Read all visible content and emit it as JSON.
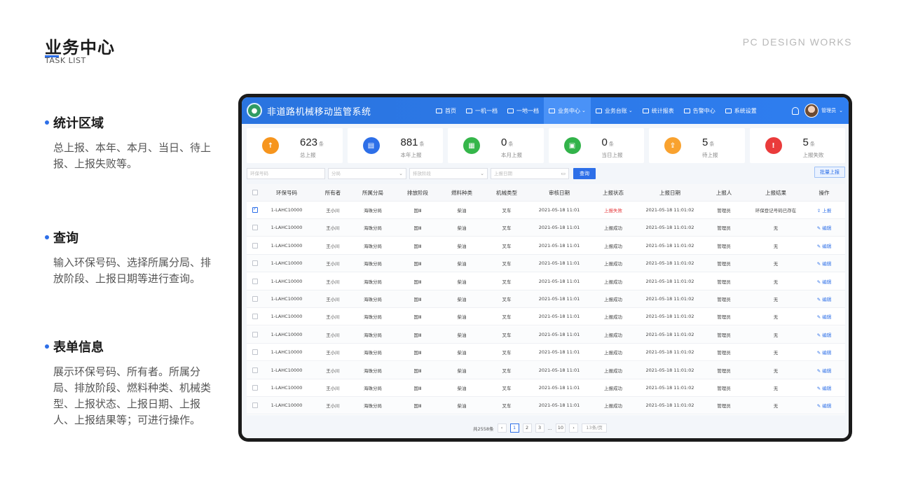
{
  "header": {
    "title": "业务中心",
    "subtitle": "TASK LIST",
    "right_caption": "PC DESIGN WORKS"
  },
  "sections": [
    {
      "title": "统计区域",
      "text": "总上报、本年、本月、当日、待上报、上报失败等。"
    },
    {
      "title": "查询",
      "text": "输入环保号码、选择所属分局、排放阶段、上报日期等进行查询。"
    },
    {
      "title": "表单信息",
      "text": "展示环保号码、所有者。所属分局、排放阶段、燃料种类、机械类型、上报状态、上报日期、上报人、上报结果等；可进行操作。"
    }
  ],
  "app": {
    "title": "非道路机械移动监管系统",
    "nav": [
      {
        "label": "首页",
        "caret": false,
        "active": false
      },
      {
        "label": "一机一档",
        "caret": false,
        "active": false
      },
      {
        "label": "一地一档",
        "caret": false,
        "active": false
      },
      {
        "label": "业务中心",
        "caret": true,
        "active": true
      },
      {
        "label": "业务台账",
        "caret": true,
        "active": false
      },
      {
        "label": "统计报表",
        "caret": false,
        "active": false
      },
      {
        "label": "告警中心",
        "caret": false,
        "active": false
      },
      {
        "label": "系统设置",
        "caret": false,
        "active": false
      }
    ],
    "user": "管理员"
  },
  "stats": [
    {
      "value": "623",
      "unit": "条",
      "label": "总上报",
      "color": "#f6951e",
      "icon": "upload-icon"
    },
    {
      "value": "881",
      "unit": "条",
      "label": "本年上报",
      "color": "#2d6fe8",
      "icon": "calendar-icon"
    },
    {
      "value": "0",
      "unit": "条",
      "label": "本月上报",
      "color": "#35b64a",
      "icon": "month-icon"
    },
    {
      "value": "0",
      "unit": "条",
      "label": "当日上报",
      "color": "#32b34a",
      "icon": "day-icon"
    },
    {
      "value": "5",
      "unit": "条",
      "label": "待上报",
      "color": "#f9a22f",
      "icon": "pending-icon"
    },
    {
      "value": "5",
      "unit": "条",
      "label": "上报失败",
      "color": "#ea3b3b",
      "icon": "fail-icon"
    }
  ],
  "search": {
    "plate_placeholder": "环保号码",
    "branch_placeholder": "分局",
    "stage_placeholder": "排放阶段",
    "date_placeholder": "上报日期",
    "query_label": "查询",
    "batch_label": "批量上报"
  },
  "table": {
    "columns": [
      "环保号码",
      "所有者",
      "所属分局",
      "排放阶段",
      "燃料种类",
      "机械类型",
      "审核日期",
      "上报状态",
      "上报日期",
      "上报人",
      "上报结果",
      "操作"
    ],
    "rows": [
      {
        "checked": true,
        "cells": [
          "1-LAHC10000",
          "王小川",
          "海珠分局",
          "国Ⅲ",
          "柴油",
          "叉车",
          "2021-05-18  11:01",
          "上报失败",
          "2021-05-18  11:01:02",
          "管理员",
          "环保登记号码已存在",
          "上报"
        ],
        "failed": true
      },
      {
        "checked": false,
        "cells": [
          "1-LAHC10000",
          "王小川",
          "海珠分局",
          "国Ⅲ",
          "柴油",
          "叉车",
          "2021-05-18  11:01",
          "上报成功",
          "2021-05-18  11:01:02",
          "管理员",
          "无",
          "编辑"
        ],
        "failed": false
      },
      {
        "checked": false,
        "cells": [
          "1-LAHC10000",
          "王小川",
          "海珠分局",
          "国Ⅲ",
          "柴油",
          "叉车",
          "2021-05-18  11:01",
          "上报成功",
          "2021-05-18  11:01:02",
          "管理员",
          "无",
          "编辑"
        ],
        "failed": false
      },
      {
        "checked": false,
        "cells": [
          "1-LAHC10000",
          "王小川",
          "海珠分局",
          "国Ⅲ",
          "柴油",
          "叉车",
          "2021-05-18  11:01",
          "上报成功",
          "2021-05-18  11:01:02",
          "管理员",
          "无",
          "编辑"
        ],
        "failed": false
      },
      {
        "checked": false,
        "cells": [
          "1-LAHC10000",
          "王小川",
          "海珠分局",
          "国Ⅲ",
          "柴油",
          "叉车",
          "2021-05-18  11:01",
          "上报成功",
          "2021-05-18  11:01:02",
          "管理员",
          "无",
          "编辑"
        ],
        "failed": false
      },
      {
        "checked": false,
        "cells": [
          "1-LAHC10000",
          "王小川",
          "海珠分局",
          "国Ⅲ",
          "柴油",
          "叉车",
          "2021-05-18  11:01",
          "上报成功",
          "2021-05-18  11:01:02",
          "管理员",
          "无",
          "编辑"
        ],
        "failed": false
      },
      {
        "checked": false,
        "cells": [
          "1-LAHC10000",
          "王小川",
          "海珠分局",
          "国Ⅲ",
          "柴油",
          "叉车",
          "2021-05-18  11:01",
          "上报成功",
          "2021-05-18  11:01:02",
          "管理员",
          "无",
          "编辑"
        ],
        "failed": false
      },
      {
        "checked": false,
        "cells": [
          "1-LAHC10000",
          "王小川",
          "海珠分局",
          "国Ⅲ",
          "柴油",
          "叉车",
          "2021-05-18  11:01",
          "上报成功",
          "2021-05-18  11:01:02",
          "管理员",
          "无",
          "编辑"
        ],
        "failed": false
      },
      {
        "checked": false,
        "cells": [
          "1-LAHC10000",
          "王小川",
          "海珠分局",
          "国Ⅲ",
          "柴油",
          "叉车",
          "2021-05-18  11:01",
          "上报成功",
          "2021-05-18  11:01:02",
          "管理员",
          "无",
          "编辑"
        ],
        "failed": false
      },
      {
        "checked": false,
        "cells": [
          "1-LAHC10000",
          "王小川",
          "海珠分局",
          "国Ⅲ",
          "柴油",
          "叉车",
          "2021-05-18  11:01",
          "上报成功",
          "2021-05-18  11:01:02",
          "管理员",
          "无",
          "编辑"
        ],
        "failed": false
      },
      {
        "checked": false,
        "cells": [
          "1-LAHC10000",
          "王小川",
          "海珠分局",
          "国Ⅲ",
          "柴油",
          "叉车",
          "2021-05-18  11:01",
          "上报成功",
          "2021-05-18  11:01:02",
          "管理员",
          "无",
          "编辑"
        ],
        "failed": false
      },
      {
        "checked": false,
        "cells": [
          "1-LAHC10000",
          "王小川",
          "海珠分局",
          "国Ⅲ",
          "柴油",
          "叉车",
          "2021-05-18  11:01",
          "上报成功",
          "2021-05-18  11:01:02",
          "管理员",
          "无",
          "编辑"
        ],
        "failed": false
      }
    ]
  },
  "pagination": {
    "total": "共2558条",
    "pages": [
      "1",
      "2",
      "3",
      "...",
      "10"
    ],
    "current": "1",
    "page_size": "13条/页"
  }
}
